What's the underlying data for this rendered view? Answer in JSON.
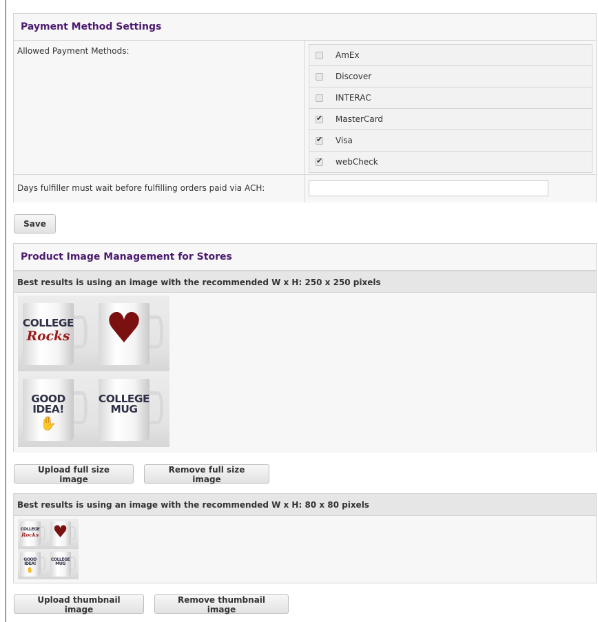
{
  "payment": {
    "title": "Payment Method Settings",
    "allowed_label": "Allowed Payment Methods:",
    "methods": [
      {
        "label": "AmEx",
        "checked": false
      },
      {
        "label": "Discover",
        "checked": false
      },
      {
        "label": "INTERAC",
        "checked": false
      },
      {
        "label": "MasterCard",
        "checked": true
      },
      {
        "label": "Visa",
        "checked": true
      },
      {
        "label": "webCheck",
        "checked": true
      }
    ],
    "ach_label": "Days fulfiller must wait before fulfilling orders paid via ACH:",
    "ach_value": ""
  },
  "save_label": "Save",
  "images": {
    "title": "Product Image Management for Stores",
    "full_hint": "Best results is using an image with the recommended W x H: 250 x 250 pixels",
    "thumb_hint": "Best results is using an image with the recommended W x H: 80 x 80 pixels",
    "upload_full_label": "Upload full size image",
    "remove_full_label": "Remove full size image",
    "upload_thumb_label": "Upload thumbnail image",
    "remove_thumb_label": "Remove thumbnail image",
    "mugs": [
      {
        "line1": "COLLEGE",
        "script": "Rocks"
      },
      {
        "line1": "",
        "script": ""
      },
      {
        "line1": "GOOD",
        "line2": "IDEA!"
      },
      {
        "line1": "COLLEGE",
        "line2": "MUG"
      }
    ]
  }
}
